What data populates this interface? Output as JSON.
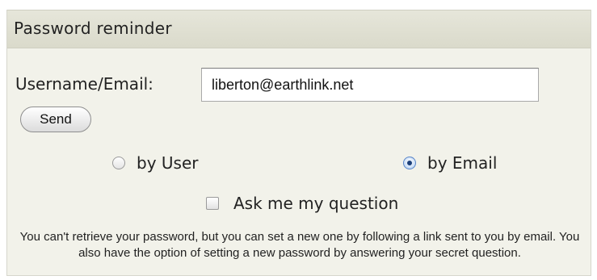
{
  "panel": {
    "title": "Password reminder"
  },
  "form": {
    "username_label": "Username/Email:",
    "username_value": "liberton@earthlink.net",
    "send_label": "Send",
    "radio_user_label": "by User",
    "radio_email_label": "by Email",
    "selected_option": "by Email",
    "ask_question_label": "Ask me my question",
    "ask_question_checked": false,
    "help_text": "You can't retrieve your password, but you can set a new one by following a link sent to you by email. You also have the option of setting a new password by answering your secret question."
  }
}
